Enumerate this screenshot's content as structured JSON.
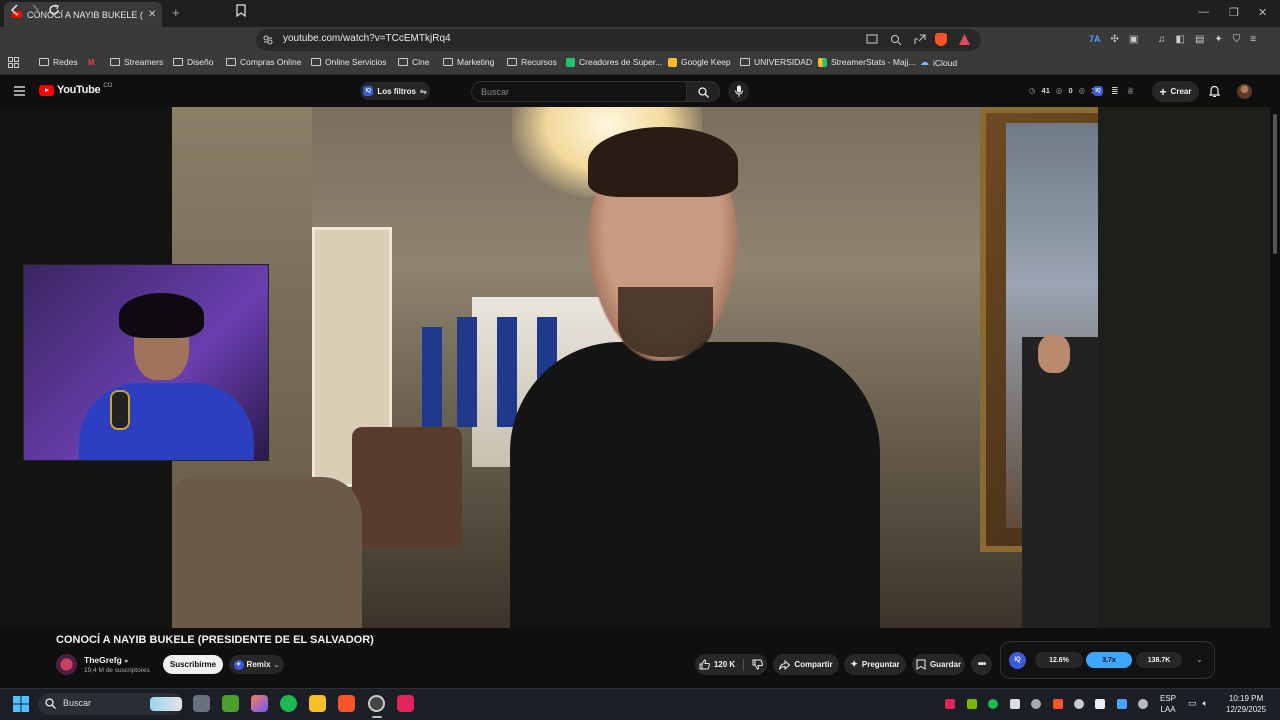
{
  "browser": {
    "tab_title": "CONOCÍ A NAYIB BUKELE (PRESI…",
    "url": "youtube.com/watch?v=TCcEMTkjRq4",
    "bookmarks": [
      "Redes",
      "Streamers",
      "Diseño",
      "Compras Online",
      "Online Servicios",
      "Cine",
      "Marketing",
      "Recursos",
      "Creadores de Super...",
      "Google Keep",
      "UNIVERSIDAD",
      "StreamerStats - Majj...",
      "iCloud"
    ]
  },
  "youtube": {
    "logo_text": "YouTube",
    "logo_country": "CO",
    "filters_label": "Los filtros",
    "search_placeholder": "Buscar",
    "counters": [
      "41",
      "0",
      "1"
    ],
    "create_label": "Crear"
  },
  "video": {
    "title": "CONOCÍ A NAYIB BUKELE (PRESIDENTE DE EL SALVADOR)",
    "channel": "TheGrefg",
    "subscribers": "19,4 M de suscriptores",
    "subscribe_label": "Suscribirme",
    "remix_label": "Remix",
    "likes": "120 K",
    "share_label": "Compartir",
    "ask_label": "Preguntar",
    "save_label": "Guardar",
    "stats": [
      "12.6%",
      "3.7x",
      "138.7K"
    ]
  },
  "taskbar": {
    "search_placeholder": "Buscar",
    "lang_top": "ESP",
    "lang_bottom": "LAA",
    "time": "10:19 PM",
    "date": "12/29/2025"
  },
  "colors": {
    "yt_red": "#ff0000",
    "accent_blue": "#3ea6ff",
    "subscribe_bg": "#f1f1f1"
  }
}
